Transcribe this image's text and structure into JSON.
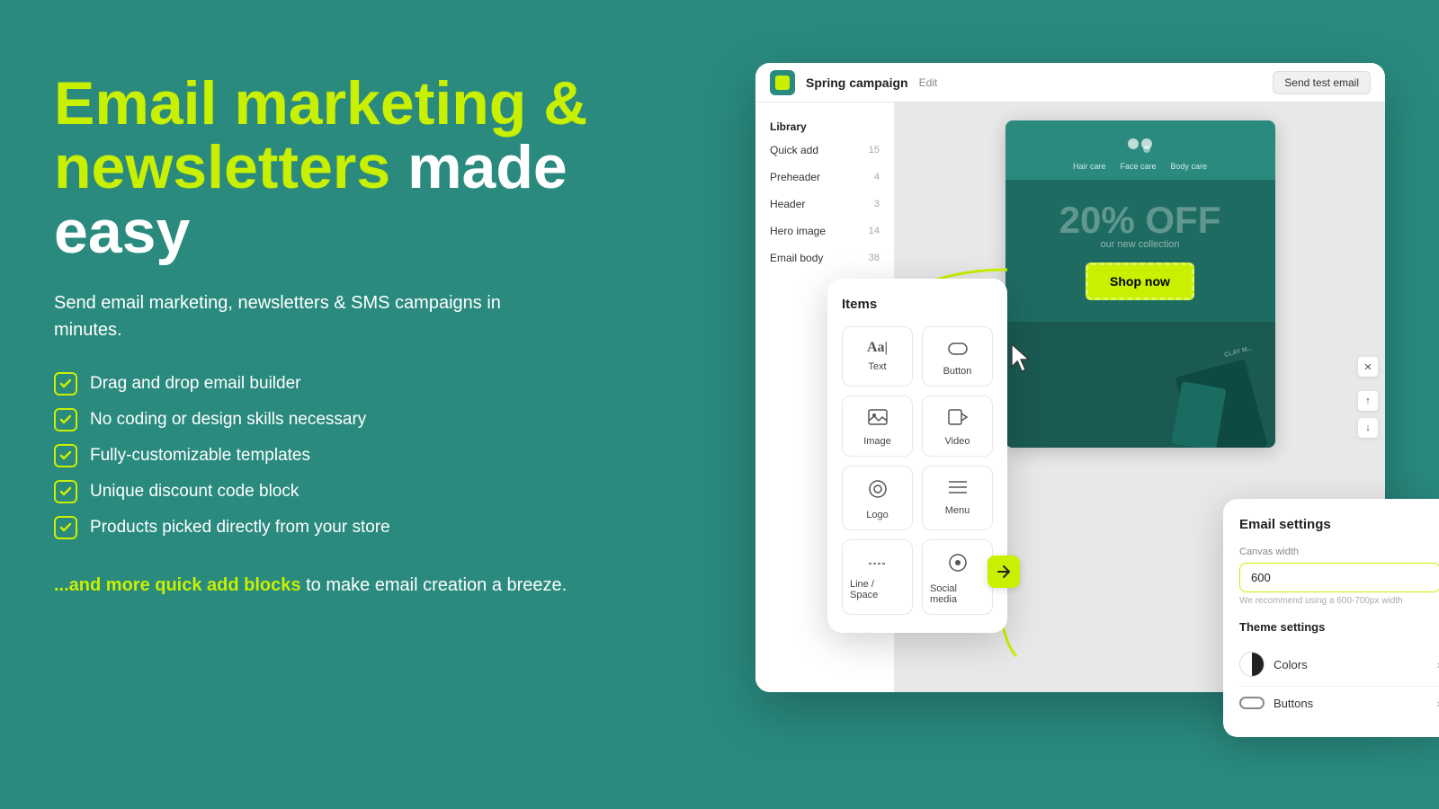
{
  "background_color": "#2a8a7e",
  "left": {
    "headline_green": "Email marketing &",
    "headline_green2": "newsletters",
    "headline_white": "made",
    "headline_white2": "easy",
    "subtitle": "Send email marketing, newsletters & SMS campaigns in minutes.",
    "checklist": [
      "Drag and drop email builder",
      "No coding or design skills necessary",
      "Fully-customizable templates",
      "Unique discount code block",
      "Products picked directly from your store"
    ],
    "cta_green": "...and more quick add blocks",
    "cta_white": " to make email creation a breeze."
  },
  "editor": {
    "campaign_name": "Spring campaign",
    "edit_label": "Edit",
    "send_test_label": "Send test email",
    "sidebar_title": "Library",
    "sidebar_items": [
      {
        "label": "Quick add",
        "count": "15"
      },
      {
        "label": "Preheader",
        "count": "4"
      },
      {
        "label": "Header",
        "count": "3"
      },
      {
        "label": "Hero image",
        "count": "14"
      },
      {
        "label": "Email body",
        "count": "38"
      }
    ],
    "email_preview": {
      "nav_items": [
        "Hair care",
        "Face care",
        "Body care"
      ],
      "discount": "20% OFF",
      "subcopy": "our new collection",
      "shop_btn": "Shop now",
      "product_text": "CLAY M..."
    }
  },
  "items_panel": {
    "title": "Items",
    "items": [
      {
        "label": "Text",
        "icon": "Aa|"
      },
      {
        "label": "Button",
        "icon": "⊟"
      },
      {
        "label": "Image",
        "icon": "🖼"
      },
      {
        "label": "Video",
        "icon": "▶"
      },
      {
        "label": "Logo",
        "icon": "◎"
      },
      {
        "label": "Menu",
        "icon": "≡"
      },
      {
        "label": "Line / Space",
        "icon": "⚊"
      },
      {
        "label": "Social media",
        "icon": "◉"
      }
    ]
  },
  "settings_panel": {
    "title": "Email settings",
    "canvas_width_label": "Canvas width",
    "canvas_width_value": "600",
    "canvas_hint": "We recommend using a 600-700px width",
    "theme_title": "Theme settings",
    "theme_items": [
      {
        "label": "Colors",
        "icon": "colors"
      },
      {
        "label": "Buttons",
        "icon": "buttons"
      }
    ]
  }
}
